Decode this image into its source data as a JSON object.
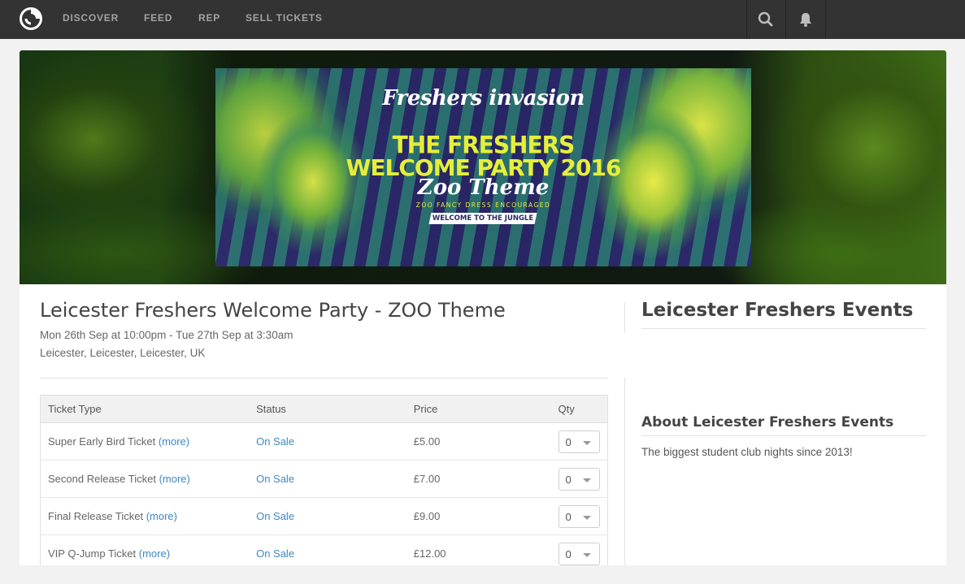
{
  "nav": {
    "links": [
      "DISCOVER",
      "FEED",
      "REP",
      "SELL TICKETS"
    ]
  },
  "banner": {
    "brand": "Freshers invasion",
    "headline_1": "THE FRESHERS",
    "headline_2": "WELCOME PARTY 2016",
    "theme": "Zoo Theme",
    "dress_note": "ZOO FANCY DRESS ENCOURAGED",
    "tagline": "WELCOME TO THE JUNGLE"
  },
  "event": {
    "title": "Leicester Freshers Welcome Party - ZOO Theme",
    "datetime": "Mon 26th Sep at 10:00pm - Tue 27th Sep at 3:30am",
    "location": "Leicester, Leicester, Leicester, UK"
  },
  "tickets": {
    "headers": [
      "Ticket Type",
      "Status",
      "Price",
      "Qty"
    ],
    "more_label": "(more)",
    "rows": [
      {
        "type": "Super Early Bird Ticket",
        "status": "On Sale",
        "price": "£5.00",
        "qty": "0"
      },
      {
        "type": "Second Release Ticket",
        "status": "On Sale",
        "price": "£7.00",
        "qty": "0"
      },
      {
        "type": "Final Release Ticket",
        "status": "On Sale",
        "price": "£9.00",
        "qty": "0"
      },
      {
        "type": "VIP Q-Jump Ticket",
        "status": "On Sale",
        "price": "£12.00",
        "qty": "0"
      }
    ]
  },
  "sidebar": {
    "organiser_title": "Leicester Freshers Events",
    "about_title": "About Leicester Freshers Events",
    "about_text": "The biggest student club nights since 2013!"
  },
  "colors": {
    "topbar": "#333333",
    "link": "#3f88c5",
    "flyer_yellow": "#e5ef3b"
  }
}
